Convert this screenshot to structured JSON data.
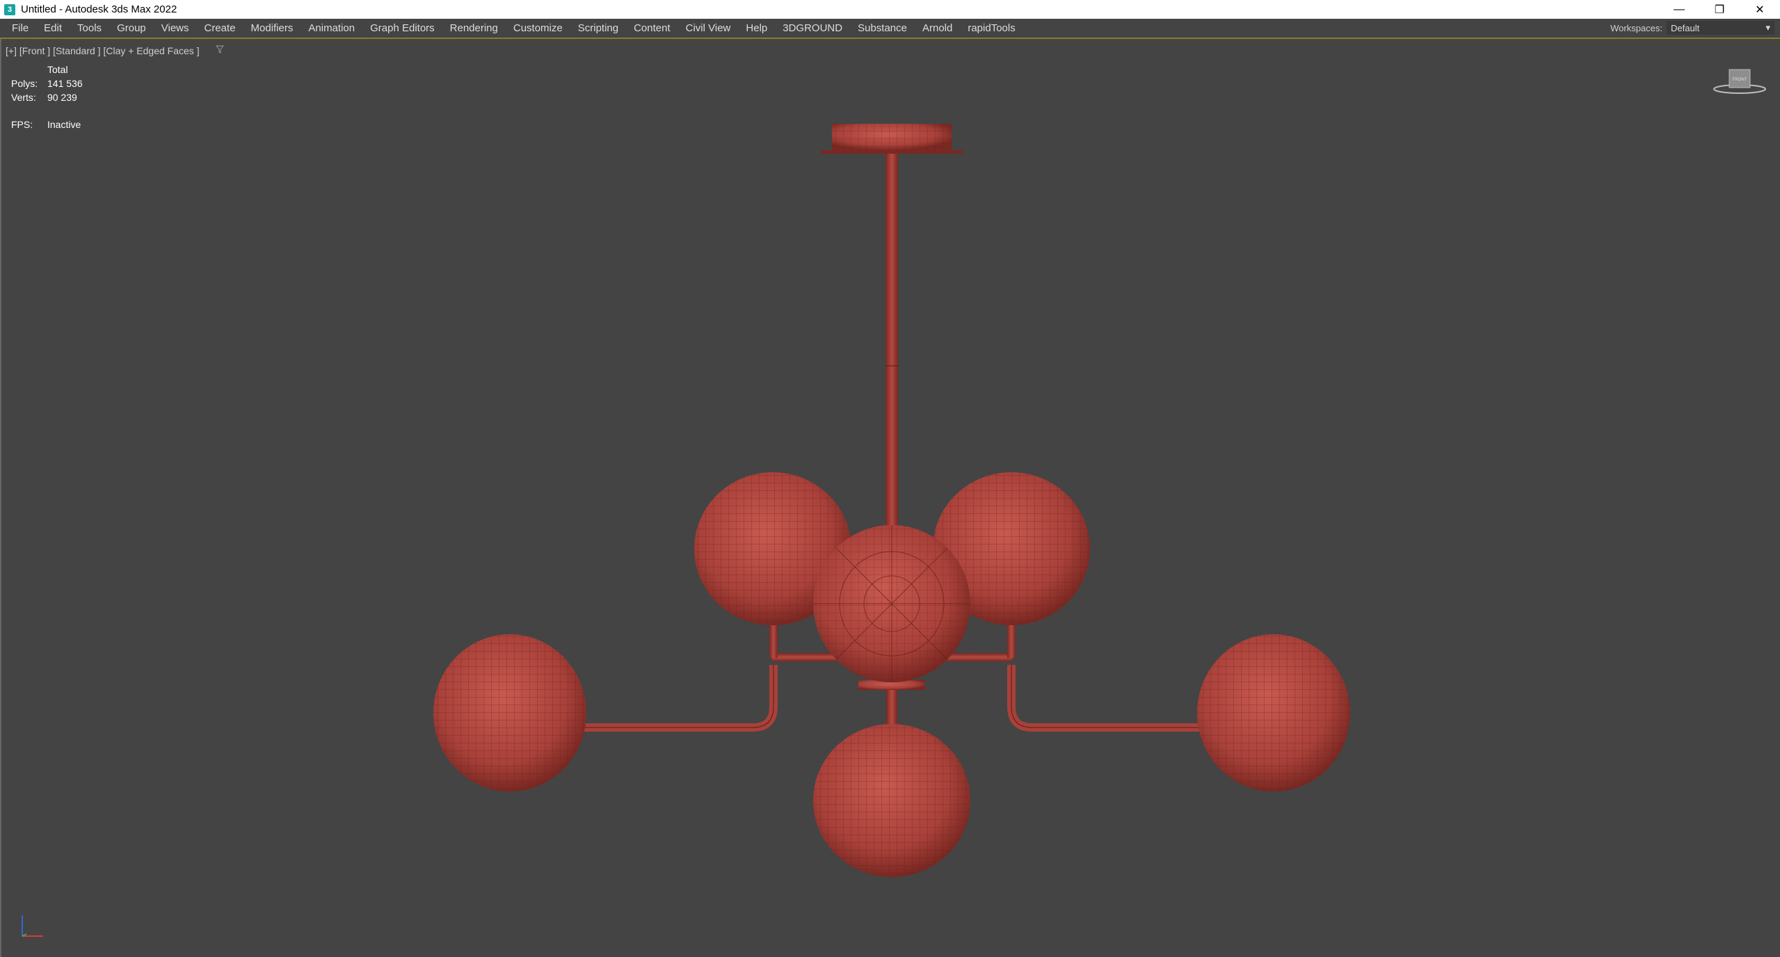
{
  "window": {
    "title": "Untitled - Autodesk 3ds Max 2022",
    "app_icon": "3",
    "controls": {
      "minimize": "—",
      "restore": "❐",
      "close": "✕"
    }
  },
  "menu": {
    "items": [
      "File",
      "Edit",
      "Tools",
      "Group",
      "Views",
      "Create",
      "Modifiers",
      "Animation",
      "Graph Editors",
      "Rendering",
      "Customize",
      "Scripting",
      "Content",
      "Civil View",
      "Help",
      "3DGROUND",
      "Substance",
      "Arnold",
      "rapidTools"
    ],
    "workspaces_label": "Workspaces:",
    "workspace_value": "Default"
  },
  "viewport": {
    "label": "[+] [Front ] [Standard ] [Clay + Edged Faces ]",
    "filter_icon": "funnel-icon",
    "stats": {
      "header": "Total",
      "polys_label": "Polys:",
      "polys_value": "141 536",
      "verts_label": "Verts:",
      "verts_value": "90 239",
      "fps_label": "FPS:",
      "fps_value": "Inactive"
    },
    "viewcube_face": "FRONT"
  },
  "colors": {
    "background": "#444444",
    "clay": "#a8413a",
    "accent_line": "#8a7b2c"
  }
}
